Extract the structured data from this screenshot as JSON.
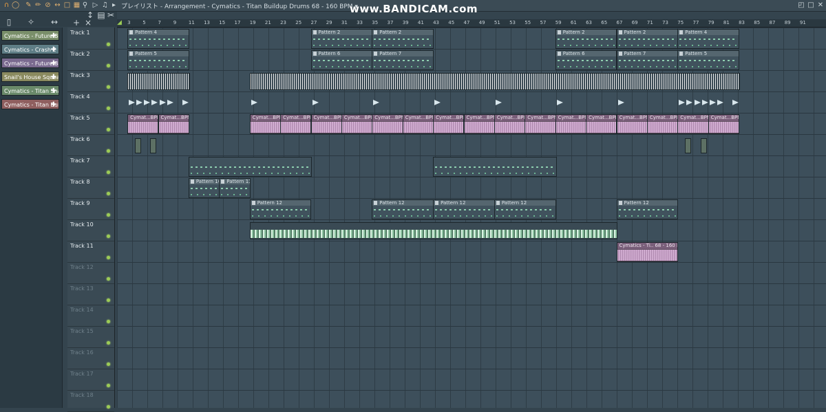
{
  "window": {
    "title": "プレイリスト - Arrangement - Cymatics - Titan Buildup Drums 68 - 160 BPM ▾",
    "watermark": "www.BANDICAM.com",
    "accent": "#9ccc55"
  },
  "toolbar_icons": [
    "magnet-icon",
    "pencil-icon",
    "paint-icon",
    "delete-icon",
    "mute-icon",
    "slip-icon",
    "select-icon",
    "zoom-icon",
    "play-icon"
  ],
  "clip_source_list": [
    {
      "label": "Cymatics - Future Ba...",
      "color": "#7a8f6a"
    },
    {
      "label": "Cymatics - Crash 2",
      "color": "#5f7e86"
    },
    {
      "label": "Cymatics - Future Ba...",
      "color": "#7a6a8f"
    },
    {
      "label": "Snail's House Squeak...",
      "color": "#8a8a5f"
    },
    {
      "label": "Cymatics - Titan Snar...",
      "color": "#6a8a6a"
    },
    {
      "label": "Cymatics - Titan Buil...",
      "color": "#8f5f5f"
    }
  ],
  "tracks": [
    {
      "label": "Track 1"
    },
    {
      "label": "Track 2"
    },
    {
      "label": "Track 3"
    },
    {
      "label": "Track 4"
    },
    {
      "label": "Track 5"
    },
    {
      "label": "Track 6"
    },
    {
      "label": "Track 7"
    },
    {
      "label": "Track 8"
    },
    {
      "label": "Track 9"
    },
    {
      "label": "Track 10"
    },
    {
      "label": "Track 11"
    },
    {
      "label": "Track 12"
    },
    {
      "label": "Track 13"
    },
    {
      "label": "Track 14"
    },
    {
      "label": "Track 15"
    },
    {
      "label": "Track 16"
    },
    {
      "label": "Track 17"
    },
    {
      "label": "Track 18"
    }
  ],
  "ruler_labels": [
    "3",
    "5",
    "7",
    "9",
    "11",
    "13",
    "15",
    "17",
    "19",
    "21",
    "23",
    "25",
    "27",
    "29",
    "31",
    "33",
    "35",
    "37",
    "39",
    "41",
    "43",
    "45",
    "47",
    "49",
    "51",
    "53",
    "55",
    "57",
    "59",
    "61",
    "63",
    "65",
    "67",
    "69",
    "71",
    "73",
    "75",
    "77",
    "79",
    "81",
    "83",
    "85",
    "87",
    "89",
    "91"
  ],
  "patterns": [
    {
      "label": "Pattern 4",
      "track": 0,
      "bar": 3,
      "len": 8
    },
    {
      "label": "Pattern 2",
      "track": 0,
      "bar": 27,
      "len": 8
    },
    {
      "label": "Pattern 2",
      "track": 0,
      "bar": 35,
      "len": 8
    },
    {
      "label": "Pattern 2",
      "track": 0,
      "bar": 59,
      "len": 8
    },
    {
      "label": "Pattern 2",
      "track": 0,
      "bar": 67,
      "len": 8
    },
    {
      "label": "Pattern 4",
      "track": 0,
      "bar": 75,
      "len": 8
    },
    {
      "label": "Pattern 5",
      "track": 1,
      "bar": 3,
      "len": 8
    },
    {
      "label": "Pattern 6",
      "track": 1,
      "bar": 27,
      "len": 8
    },
    {
      "label": "Pattern 7",
      "track": 1,
      "bar": 35,
      "len": 8
    },
    {
      "label": "Pattern 6",
      "track": 1,
      "bar": 59,
      "len": 8
    },
    {
      "label": "Pattern 7",
      "track": 1,
      "bar": 67,
      "len": 8
    },
    {
      "label": "Pattern 5",
      "track": 1,
      "bar": 75,
      "len": 8
    },
    {
      "label": "Pattern 10",
      "track": 7,
      "bar": 11,
      "len": 4
    },
    {
      "label": "Pattern 11",
      "track": 7,
      "bar": 15,
      "len": 4
    },
    {
      "label": "Pattern 12",
      "track": 8,
      "bar": 19,
      "len": 8
    },
    {
      "label": "Pattern 12",
      "track": 8,
      "bar": 35,
      "len": 8
    },
    {
      "label": "Pattern 12",
      "track": 8,
      "bar": 43,
      "len": 8
    },
    {
      "label": "Pattern 12",
      "track": 8,
      "bar": 51,
      "len": 8
    },
    {
      "label": "Pattern 12",
      "track": 8,
      "bar": 67,
      "len": 8
    }
  ],
  "audio_clips": [
    {
      "label": "Cymat...BPM",
      "track": 4,
      "bar": 3,
      "len": 4
    },
    {
      "label": "Cymat...BPM",
      "track": 4,
      "bar": 7,
      "len": 4
    },
    {
      "label": "Cymat...BPM",
      "track": 4,
      "bar": 19,
      "len": 4
    },
    {
      "label": "Cymat...BPM",
      "track": 4,
      "bar": 23,
      "len": 4
    },
    {
      "label": "Cymat...BPM",
      "track": 4,
      "bar": 27,
      "len": 4
    },
    {
      "label": "Cymat...BPM",
      "track": 4,
      "bar": 31,
      "len": 4
    },
    {
      "label": "Cymat...BPM",
      "track": 4,
      "bar": 35,
      "len": 4
    },
    {
      "label": "Cymat...BPM",
      "track": 4,
      "bar": 39,
      "len": 4
    },
    {
      "label": "Cymat...BPM",
      "track": 4,
      "bar": 43,
      "len": 4
    },
    {
      "label": "Cymat...BPM",
      "track": 4,
      "bar": 47,
      "len": 4
    },
    {
      "label": "Cymat...BPM",
      "track": 4,
      "bar": 51,
      "len": 4
    },
    {
      "label": "Cymat...BPM",
      "track": 4,
      "bar": 55,
      "len": 4
    },
    {
      "label": "Cymat...BPM",
      "track": 4,
      "bar": 59,
      "len": 4
    },
    {
      "label": "Cymat...BPM",
      "track": 4,
      "bar": 63,
      "len": 4
    },
    {
      "label": "Cymat...BPM",
      "track": 4,
      "bar": 67,
      "len": 4
    },
    {
      "label": "Cymat...BPM",
      "track": 4,
      "bar": 71,
      "len": 4
    },
    {
      "label": "Cymat...BPM",
      "track": 4,
      "bar": 75,
      "len": 4
    },
    {
      "label": "Cymat...BPM",
      "track": 4,
      "bar": 79,
      "len": 4
    },
    {
      "label": "Cymatics - Ti.. 68 - 160 BPM",
      "track": 10,
      "bar": 67,
      "len": 8
    }
  ]
}
